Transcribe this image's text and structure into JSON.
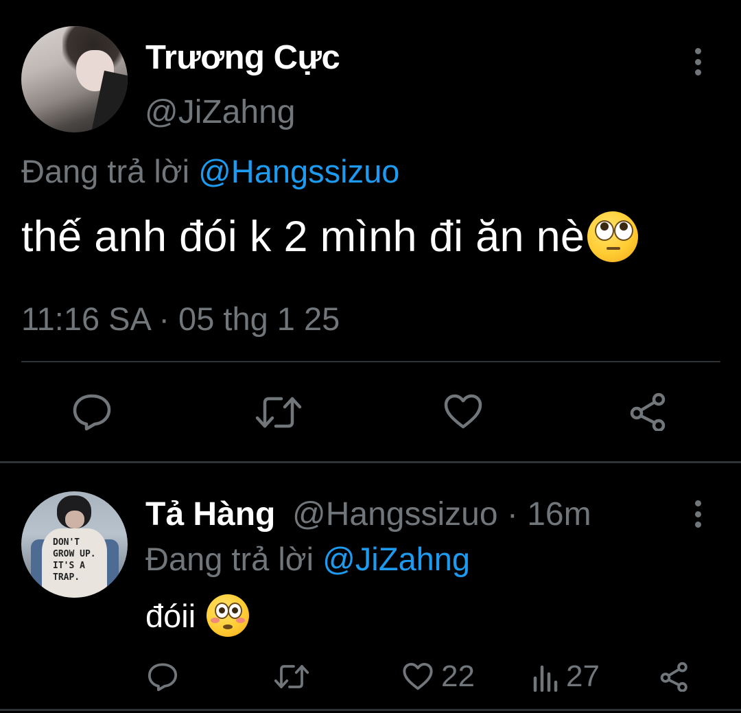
{
  "main_tweet": {
    "author_name": "Trương Cực",
    "author_handle": "@JiZahng",
    "replying_prefix": "Đang trả lời ",
    "replying_to": "@Hangssizuo",
    "text": "thế anh đói k 2 mình đi ăn nè",
    "emoji": "face-with-rolling-eyes",
    "timestamp": "11:16 SA · 05 thg 1 25"
  },
  "reply_tweet": {
    "author_name": "Tả Hàng",
    "author_handle_time": "@Hangssizuo · 16m",
    "replying_prefix": "Đang trả lời ",
    "replying_to": "@JiZahng",
    "text": "đóii",
    "emoji": "flushed-face",
    "likes": "22",
    "views": "27"
  },
  "avatar_shirt_text": "DON'T GROW UP. IT'S A TRAP.",
  "colors": {
    "background": "#000000",
    "text_primary": "#ffffff",
    "text_secondary": "#71767b",
    "link": "#1d9bf0",
    "divider": "#2f3336"
  },
  "icons": {
    "reply": "reply-icon",
    "retweet": "retweet-icon",
    "like": "heart-icon",
    "share": "share-icon",
    "views": "views-icon",
    "more": "more-icon"
  }
}
